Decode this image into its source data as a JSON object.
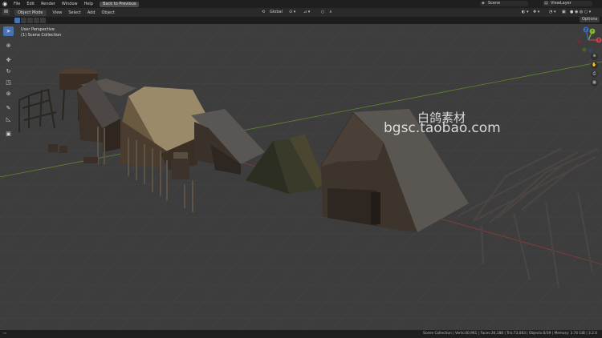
{
  "topbar": {
    "menus": [
      "File",
      "Edit",
      "Render",
      "Window",
      "Help"
    ],
    "back_button": "Back to Previous",
    "scene": "Scene",
    "view_layer": "ViewLayer"
  },
  "header": {
    "mode": "Object Mode",
    "menus": [
      "View",
      "Select",
      "Add",
      "Object"
    ],
    "orientation": "Global",
    "options": "Options"
  },
  "viewport": {
    "perspective": "User Perspective",
    "collection": "(1) Scene Collection",
    "bg_color": "#3d3d3d"
  },
  "watermark": {
    "line1": "白鸽素材",
    "line2": "bgsc.taobao.com"
  },
  "gizmo": {
    "x_label": "X",
    "y_label": "Y",
    "z_label": "Z"
  },
  "status": {
    "text": "Scene Collection | Verts:40,961 | Faces:36,188 | Tris:73,083 | Objects:0/39 | Memory: 3.74 GiB | 3.2.0"
  },
  "icons": [
    "blender-logo",
    "select-box-icon",
    "cursor-icon",
    "move-icon",
    "rotate-icon",
    "scale-icon",
    "transform-icon",
    "annotate-icon",
    "measure-icon",
    "add-cube-icon",
    "zoom-icon",
    "pan-icon",
    "camera-icon",
    "grid-icon"
  ],
  "colors": {
    "accent": "#4772b3",
    "x_axis": "#a33a3a",
    "y_axis": "#6a9a2a",
    "z_axis": "#3b6ec4"
  }
}
